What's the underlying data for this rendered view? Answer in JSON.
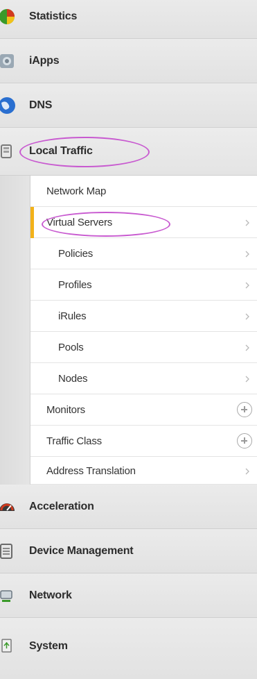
{
  "nav": {
    "top_items": [
      {
        "label": "Statistics",
        "icon": "pie-chart-icon"
      },
      {
        "label": "iApps",
        "icon": "gear-icon"
      },
      {
        "label": "DNS",
        "icon": "globe-icon"
      },
      {
        "label": "Local Traffic",
        "icon": "local-traffic-icon"
      }
    ],
    "bottom_items": [
      {
        "label": "Acceleration",
        "icon": "speedometer-icon"
      },
      {
        "label": "Device Management",
        "icon": "device-icon"
      },
      {
        "label": "Network",
        "icon": "network-icon"
      },
      {
        "label": "System",
        "icon": "system-icon"
      }
    ]
  },
  "submenu": {
    "items": [
      {
        "label": "Network Map",
        "indent": false,
        "action": "none"
      },
      {
        "label": "Virtual Servers",
        "indent": false,
        "action": "chevron",
        "active": true
      },
      {
        "label": "Policies",
        "indent": true,
        "action": "chevron"
      },
      {
        "label": "Profiles",
        "indent": true,
        "action": "chevron"
      },
      {
        "label": "iRules",
        "indent": true,
        "action": "chevron"
      },
      {
        "label": "Pools",
        "indent": true,
        "action": "chevron"
      },
      {
        "label": "Nodes",
        "indent": true,
        "action": "chevron"
      },
      {
        "label": "Monitors",
        "indent": false,
        "action": "plus"
      },
      {
        "label": "Traffic Class",
        "indent": false,
        "action": "plus"
      },
      {
        "label": "Address Translation",
        "indent": false,
        "action": "chevron"
      }
    ]
  },
  "colors": {
    "active_bar": "#f2b21a",
    "annotation": "#c85ad0"
  }
}
